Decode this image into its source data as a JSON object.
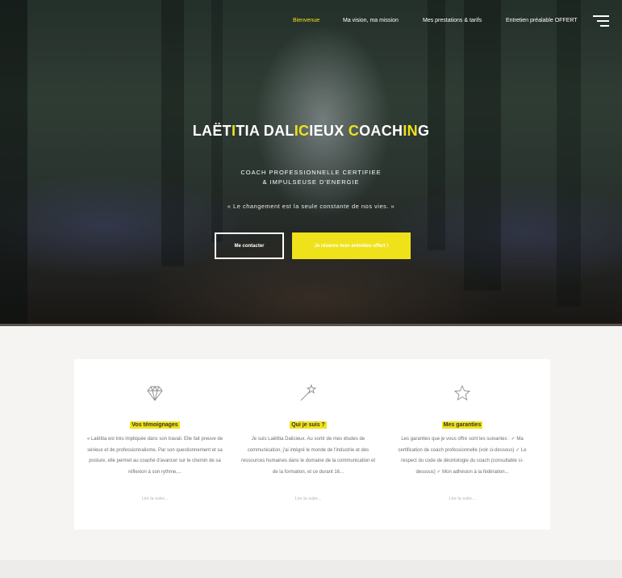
{
  "nav": {
    "items": [
      {
        "label": "Bienvenue",
        "active": true
      },
      {
        "label": "Ma vision, ma mission",
        "active": false
      },
      {
        "label": "Mes prestations & tarifs",
        "active": false
      },
      {
        "label": "Entretien préalable OFFERT",
        "active": false
      }
    ],
    "menu_icon": "hamburger-icon"
  },
  "hero": {
    "title_parts": [
      "LAËT",
      "I",
      "TIA DAL",
      "IC",
      "IEUX ",
      "C",
      "OACH",
      "IN",
      "G"
    ],
    "subtitle_line1": "COACH PROFESSIONNELLE CERTIFIEE",
    "subtitle_line2": "& IMPULSEUSE D'ENERGIE",
    "quote": "« Le changement est la seule constante de nos vies. »",
    "button_contact": "Me contacter",
    "button_reserve": "Je réserve mon entretien offert !"
  },
  "columns": [
    {
      "icon": "diamond-icon",
      "title": "Vos témoignages",
      "text": "« Laëtitia est très impliquée dans son travail. Elle fait preuve de sérieux et de professionnalisme. Par son questionnement et sa posture, elle permet au coaché d'avancer sur le chemin de sa réflexion à son rythme,...",
      "link": "Lire la suite..."
    },
    {
      "icon": "magic-wand-icon",
      "title": "Qui je suis ?",
      "text": "Je suis Laëtitia Dalicieux. Au sortir de mes études de communication, j'ai intégré le monde de l'industrie et des ressources humaines dans le domaine de la communication et de la formation, et ce durant 16...",
      "link": "Lire la suite..."
    },
    {
      "icon": "star-icon",
      "title": "Mes garanties",
      "text": "Les garanties que je vous offre sont les suivantes : ✓ Ma certification de coach professionnelle (voir ci-dessous) ✓ Le respect du code de déontologie du coach (consultable ci-dessous) ✓ Mon adhésion à la fédération...",
      "link": "Lire la suite..."
    }
  ],
  "colors": {
    "accent": "#f0e21a",
    "text_muted": "#6e6e6e",
    "background": "#f5f4f2"
  }
}
